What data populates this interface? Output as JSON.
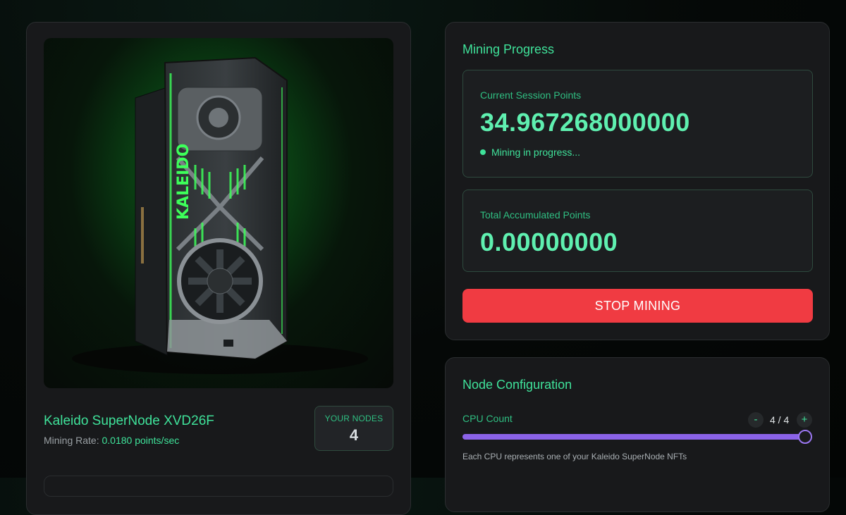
{
  "node_card": {
    "image_alt": "Kaleido GPU render",
    "gpu_brand": "KALEIDO",
    "name": "Kaleido SuperNode XVD26F",
    "mining_rate_label": "Mining Rate:",
    "mining_rate_value": "0.0180 points/sec",
    "your_nodes_label": "YOUR NODES",
    "your_nodes_count": "4"
  },
  "progress": {
    "title": "Mining Progress",
    "session_label": "Current Session Points",
    "session_value": "34.967268000000",
    "status_text": "Mining in progress...",
    "total_label": "Total Accumulated Points",
    "total_value": "0.00000000",
    "stop_button": "STOP MINING"
  },
  "config": {
    "title": "Node Configuration",
    "cpu_label": "CPU Count",
    "cpu_value": "4 / 4",
    "cpu_fraction": 1.0,
    "decrement": "-",
    "increment": "+",
    "hint": "Each CPU represents one of your Kaleido SuperNode NFTs"
  },
  "colors": {
    "accent": "#3fe29a",
    "danger": "#f03b42",
    "slider": "#8b63e8"
  }
}
